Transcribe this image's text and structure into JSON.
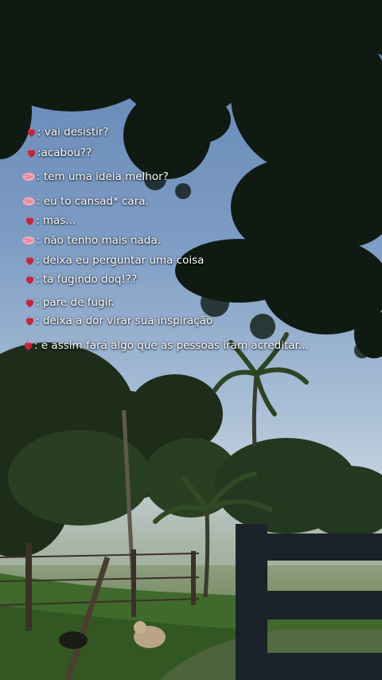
{
  "dialogue": [
    {
      "speaker": "heart",
      "text": ": vai desistir?"
    },
    {
      "speaker": "heart",
      "text": ":acabou??"
    },
    {
      "speaker": "brain",
      "text": ": tem uma ideia melhor?"
    },
    {
      "speaker": "brain",
      "text": ": eu to cansad* cara."
    },
    {
      "speaker": "heart",
      "text": ": mas..."
    },
    {
      "speaker": "brain",
      "text": ": não tenho mais nada."
    },
    {
      "speaker": "heart",
      "text": ": deixa eu perguntar uma coisa"
    },
    {
      "speaker": "heart",
      "text": ": ta fugindo doq!??"
    },
    {
      "speaker": "heart",
      "text": ": pare de fugir."
    },
    {
      "speaker": "heart",
      "text": ": deixa a dor virar sua inspiração"
    },
    {
      "speaker": "heart",
      "text": ": e assim fará algo que as pessoas iram acreditar..."
    }
  ],
  "icons": {
    "heart": "anatomical-heart-icon",
    "brain": "brain-icon"
  },
  "colors": {
    "heart": "#c0273a",
    "brain": "#f2a6b6",
    "sky": "#6f8fb6",
    "foliage": "#0f1a12"
  }
}
